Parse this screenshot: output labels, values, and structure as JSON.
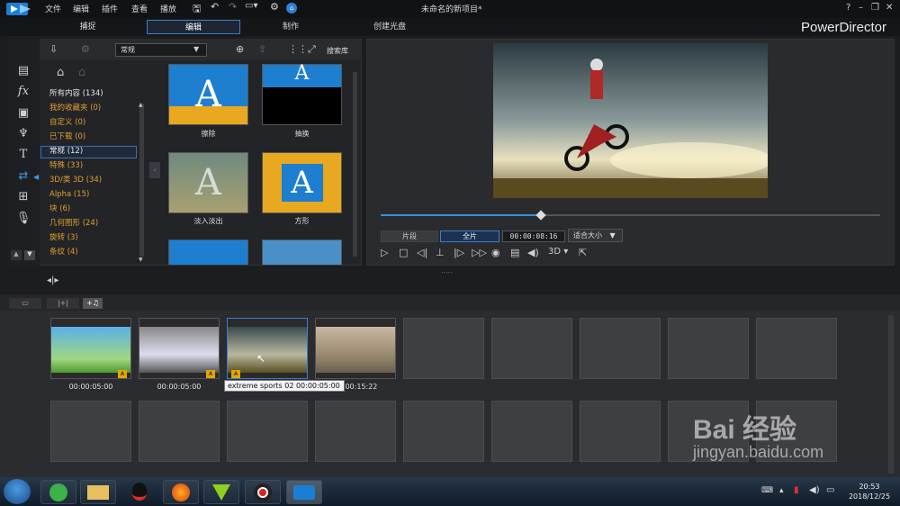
{
  "menu": [
    "文件",
    "编辑",
    "插件",
    "查看",
    "播放"
  ],
  "window_title": "未命名的新项目*",
  "modes": [
    "捕捉",
    "编辑",
    "制作",
    "创建光盘"
  ],
  "brand": "PowerDirector",
  "library": {
    "dropdown": "常规",
    "search_label": "搜索库",
    "categories": [
      {
        "label": "所有内容 (134)"
      },
      {
        "label": "我的收藏夹 (0)"
      },
      {
        "label": "自定义 (0)"
      },
      {
        "label": "已下载 (0)"
      },
      {
        "label": "常规 (12)"
      },
      {
        "label": "特殊 (33)"
      },
      {
        "label": "3D/类 3D (34)"
      },
      {
        "label": "Alpha (15)"
      },
      {
        "label": "块 (6)"
      },
      {
        "label": "几何图形 (24)"
      },
      {
        "label": "旋转 (3)"
      },
      {
        "label": "条纹 (4)"
      }
    ],
    "transitions": [
      {
        "label": "擦除"
      },
      {
        "label": "抽换"
      },
      {
        "label": "淡入淡出"
      },
      {
        "label": "方形"
      }
    ]
  },
  "preview": {
    "clip_button": "片段",
    "full_button": "全片",
    "timecode": "00:00:08:16",
    "fit_label": "适合大小",
    "mode_3d": "3D",
    "progress": 0.32
  },
  "storyboard": {
    "clips": [
      {
        "duration": "00:00:05:00"
      },
      {
        "duration": "00:00:05:00"
      },
      {
        "duration": ""
      },
      {
        "duration": "00:00:15:22"
      }
    ],
    "tooltip": "extreme sports 02 00:00:05:00"
  },
  "taskbar": {
    "time": "20:53",
    "date": "2018/12/25"
  },
  "watermark": {
    "line1": "Bai 经验",
    "line2": "jingyan.baidu.com"
  }
}
